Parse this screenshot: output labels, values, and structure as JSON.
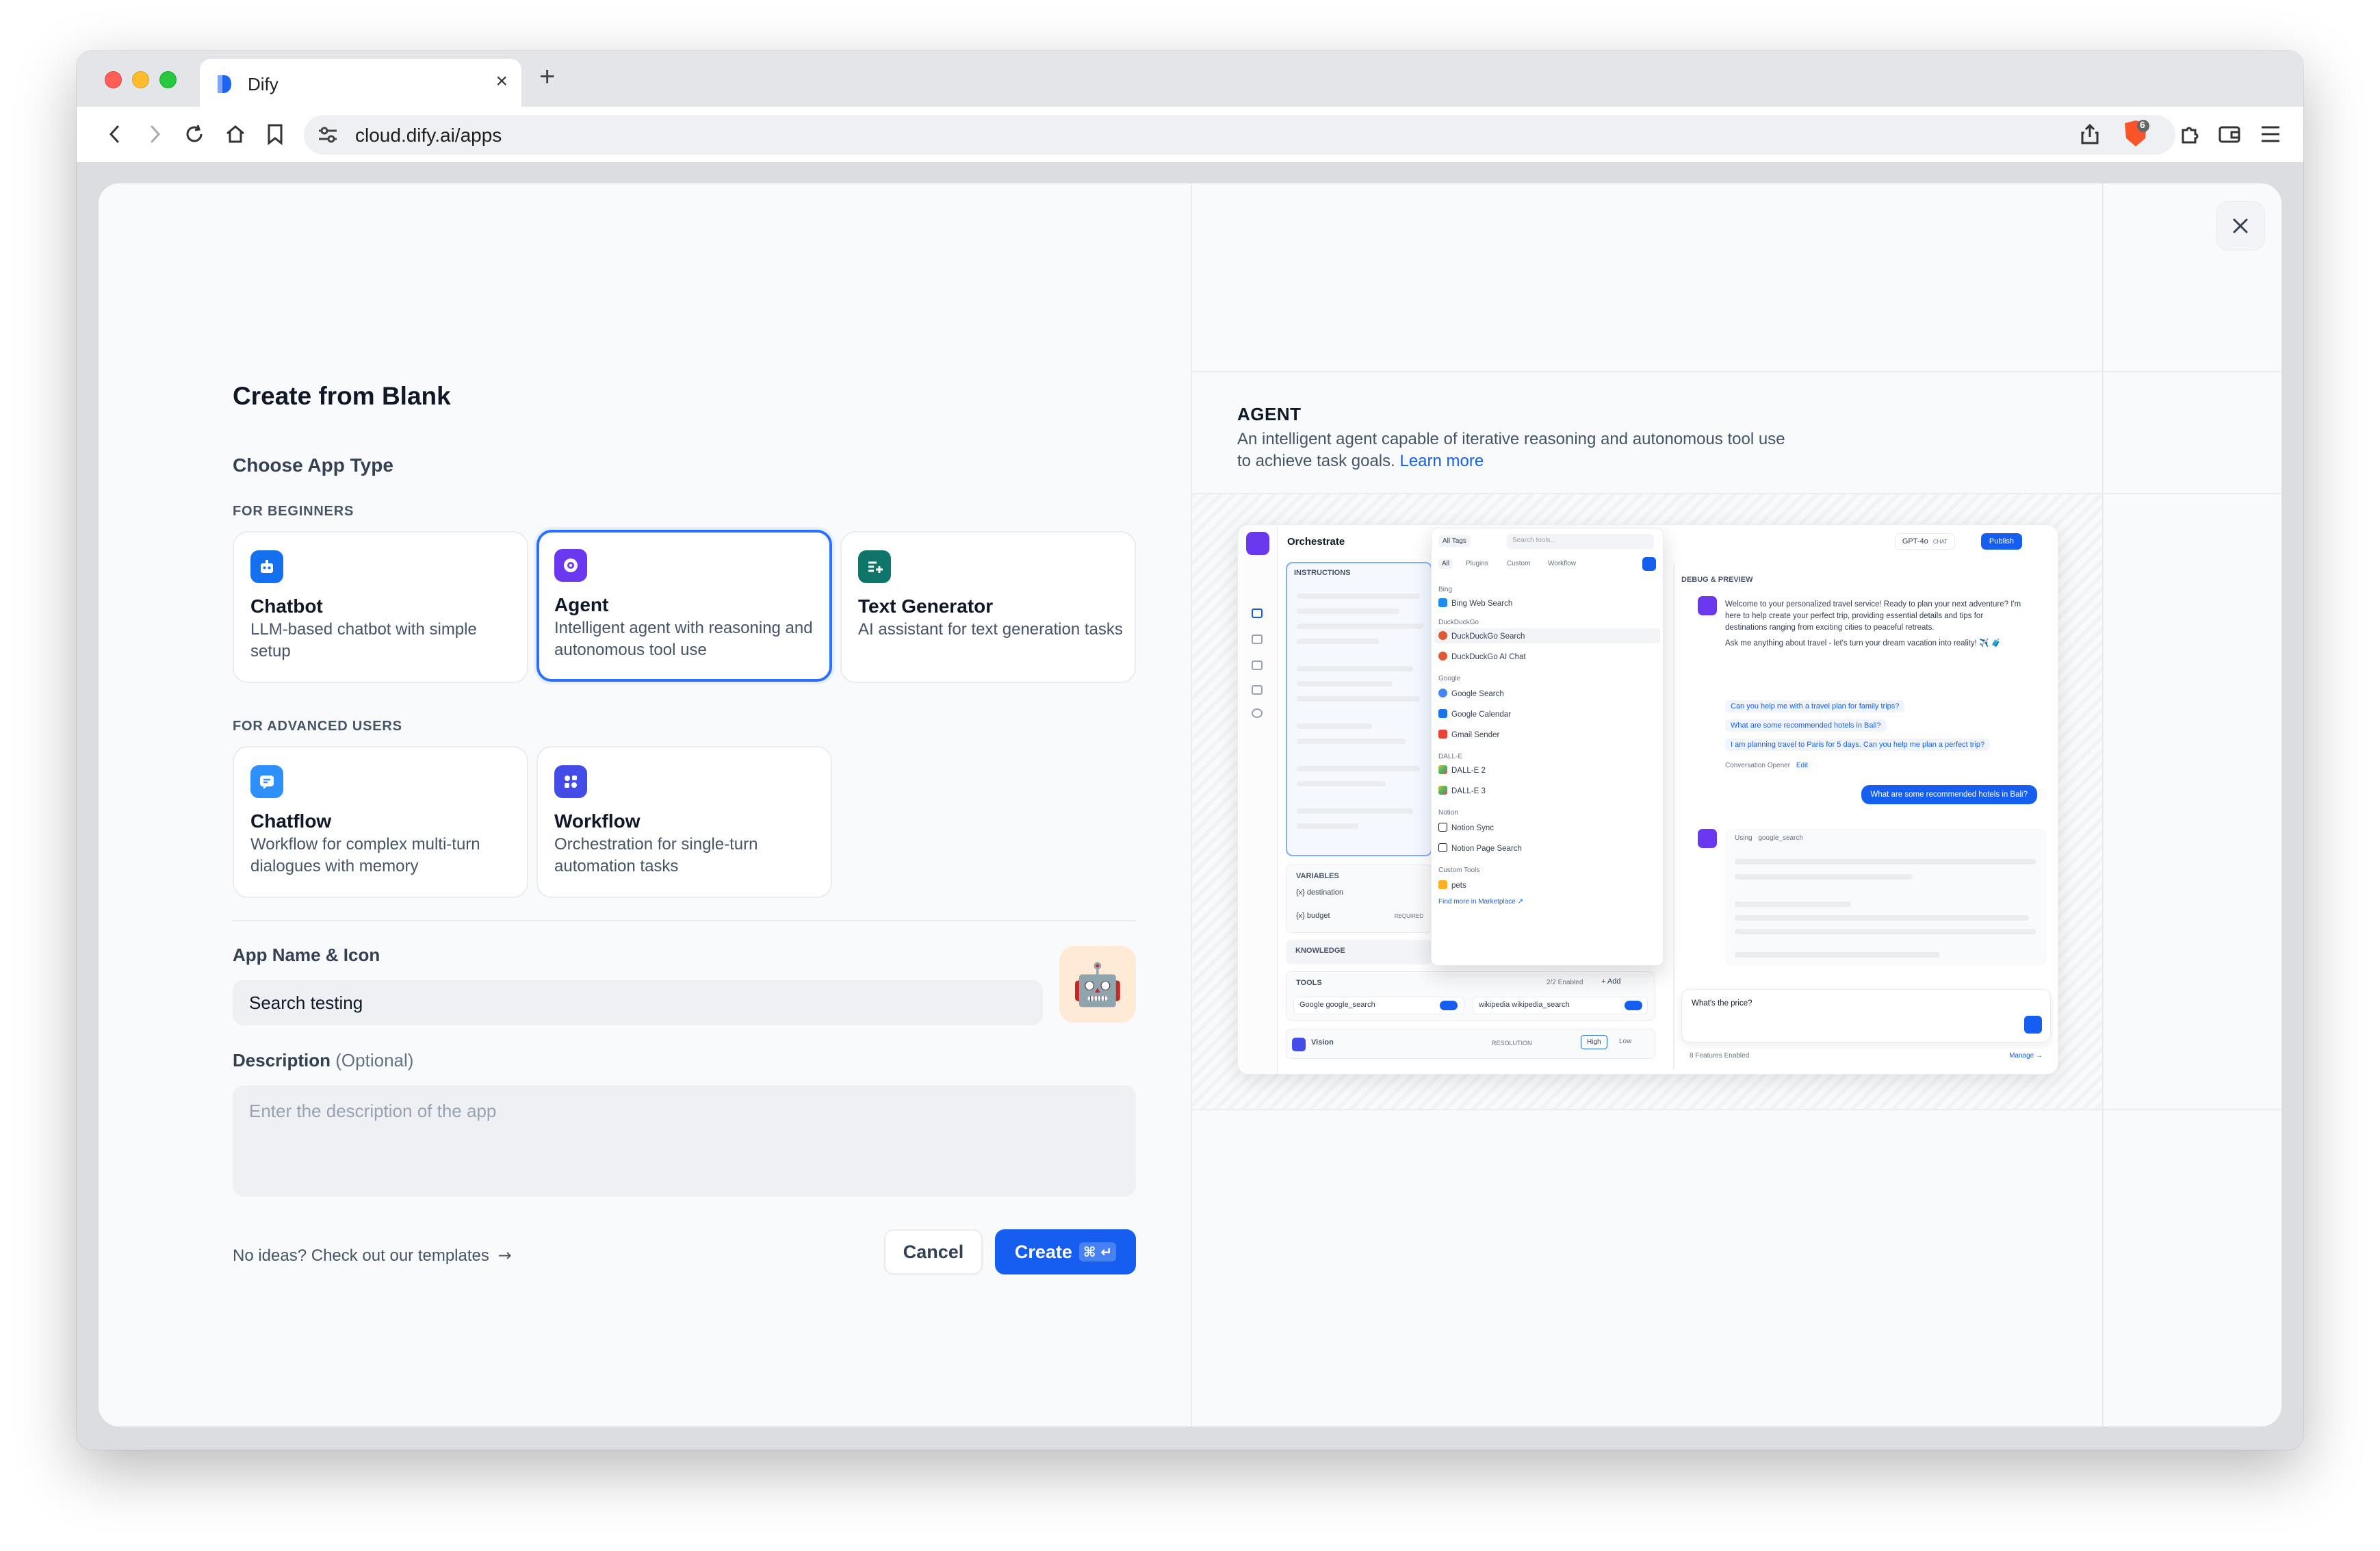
{
  "browser": {
    "tab_title": "Dify",
    "url": "cloud.dify.ai/apps",
    "shield_badge": "6"
  },
  "modal": {
    "title": "Create from Blank",
    "choose_label": "Choose App Type",
    "beginners_label": "FOR BEGINNERS",
    "advanced_label": "FOR ADVANCED USERS",
    "beginner_cards": [
      {
        "title": "Chatbot",
        "desc": "LLM-based chatbot with simple setup",
        "icon": "chatbot-icon",
        "color": "#1570ef"
      },
      {
        "title": "Agent",
        "desc": "Intelligent agent with reasoning and autonomous tool use",
        "icon": "agent-icon",
        "color": "#6938ef"
      },
      {
        "title": "Text Generator",
        "desc": "AI assistant for text generation tasks",
        "icon": "text-generator-icon",
        "color": "#107569"
      }
    ],
    "advanced_cards": [
      {
        "title": "Chatflow",
        "desc": "Workflow for complex multi-turn dialogues with memory",
        "icon": "chatflow-icon",
        "color": "#2e90fa"
      },
      {
        "title": "Workflow",
        "desc": "Orchestration for single-turn automation tasks",
        "icon": "workflow-icon",
        "color": "#444ce7"
      }
    ],
    "selected_type": "Agent",
    "name_label": "App Name & Icon",
    "name_value": "Search testing",
    "app_icon_emoji": "🤖",
    "desc_label": "Description",
    "desc_optional": "(Optional)",
    "desc_placeholder": "Enter the description of the app",
    "templates_link": "No ideas? Check out our templates",
    "cancel_label": "Cancel",
    "create_label": "Create",
    "create_kbd": "⌘ ↵"
  },
  "preview": {
    "type_title": "AGENT",
    "type_desc": "An intelligent agent capable of iterative reasoning and autonomous tool use to achieve task goals.",
    "learn_more": "Learn more",
    "mock": {
      "orchestrate": "Orchestrate",
      "instructions": "INSTRUCTIONS",
      "variables": "VARIABLES",
      "var_items": [
        "{x} destination",
        "{x} budget"
      ],
      "var_required": "REQUIRED",
      "knowledge": "KNOWLEDGE",
      "tools": "TOOLS",
      "tools_enabled": "2/2 Enabled",
      "tools_add": "+ Add",
      "tool_items": [
        "Google google_search",
        "wikipedia wikipedia_search"
      ],
      "vision": "Vision",
      "resolution": "RESOLUTION",
      "res_high": "High",
      "res_low": "Low",
      "all_tags": "All Tags",
      "search_tools": "Search tools...",
      "filter_tabs": [
        "All",
        "Plugins",
        "Custom",
        "Workflow"
      ],
      "tool_groups": [
        {
          "group": "Bing",
          "items": [
            "Bing Web Search"
          ]
        },
        {
          "group": "DuckDuckGo",
          "items": [
            "DuckDuckGo Search",
            "DuckDuckGo AI Chat"
          ]
        },
        {
          "group": "Google",
          "items": [
            "Google Search",
            "Google Calendar",
            "Gmail Sender"
          ]
        },
        {
          "group": "DALL-E",
          "items": [
            "DALL-E 2",
            "DALL-E 3"
          ]
        },
        {
          "group": "Notion",
          "items": [
            "Notion Sync",
            "Notion Page Search"
          ]
        },
        {
          "group": "Custom Tools",
          "items": [
            "pets"
          ]
        }
      ],
      "find_more": "Find more in Marketplace ↗",
      "model": "GPT-4o",
      "model_tag": "CHAT",
      "publish": "Publish",
      "debug": "DEBUG & PREVIEW",
      "welcome": "Welcome to your personalized travel service! Ready to plan your next adventure? I'm here to help create your perfect trip, providing essential details and tips for destinations ranging from exciting cities to peaceful retreats.",
      "welcome2": "Ask me anything about travel - let's turn your dream vacation into reality! ✈️ 🧳",
      "suggestions": [
        "Can you help me with a travel plan for family trips?",
        "What are some recommended hotels in Bali?",
        "I am planning travel to Paris for 5 days. Can you help me plan a perfect trip?"
      ],
      "opener": "Conversation Opener",
      "opener_edit": "Edit",
      "user_msg": "What are some recommended hotels in Bali?",
      "using": "Using",
      "using_tool": "google_search",
      "input_text": "What's the price?",
      "features": "8 Features Enabled",
      "manage": "Manage →"
    }
  }
}
